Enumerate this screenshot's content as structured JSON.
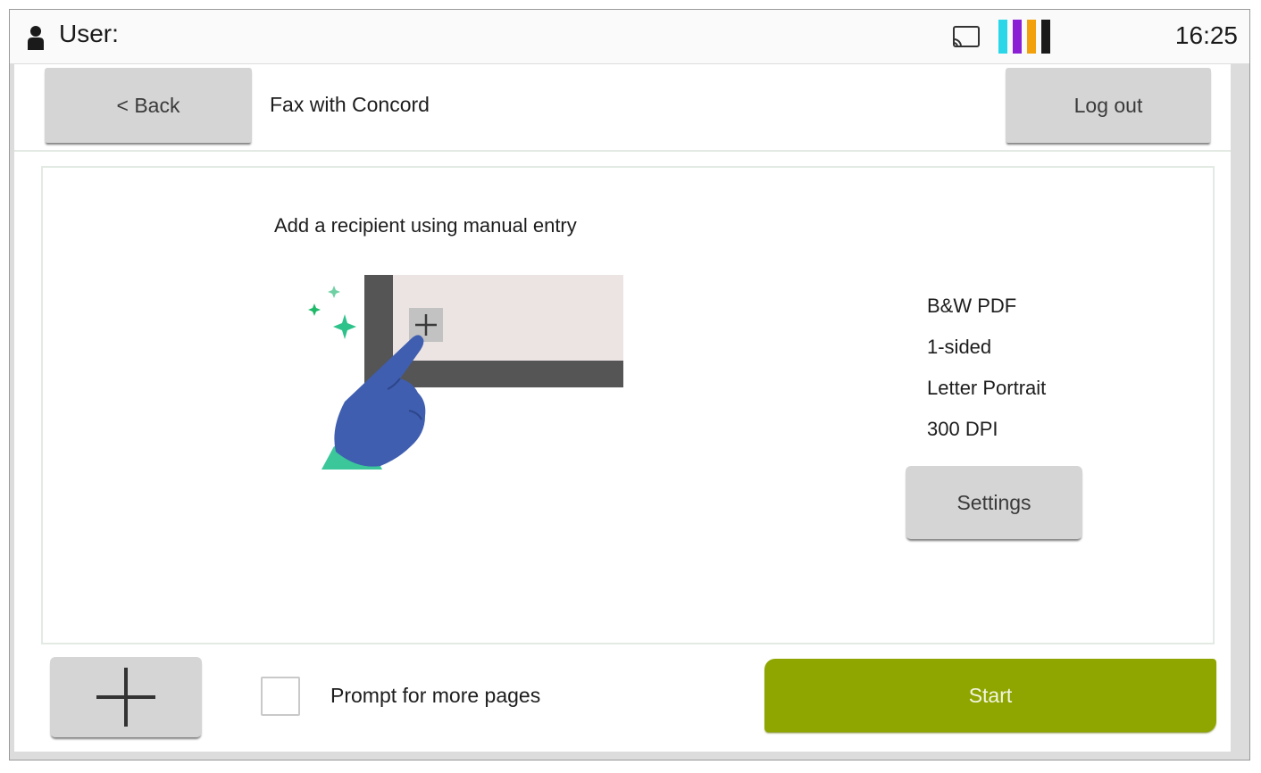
{
  "statusbar": {
    "user_label": "User:",
    "clock": "16:25",
    "icons": [
      "user-icon",
      "cast-icon",
      "ink-level-icon"
    ],
    "ink_colors": [
      "#29d7e8",
      "#8a1fd6",
      "#f2a10c",
      "#1a1a1a"
    ]
  },
  "header": {
    "back_label": "< Back",
    "title": "Fax with Concord",
    "logout_label": "Log out"
  },
  "main": {
    "instruction": "Add a recipient using manual entry",
    "illustration_icon": "tap-add-recipient-illustration",
    "settings": {
      "items": [
        "B&W PDF",
        "1-sided",
        "Letter Portrait",
        "300 DPI"
      ],
      "button_label": "Settings"
    }
  },
  "footer": {
    "add_icon": "plus-icon",
    "prompt_label": "Prompt for more pages",
    "prompt_checked": false,
    "start_label": "Start"
  },
  "colors": {
    "start_button": "#8fa600",
    "button_gray": "#d5d5d5",
    "sparkle_green": "#1fb96a",
    "hand_blue": "#3f5eb0"
  }
}
